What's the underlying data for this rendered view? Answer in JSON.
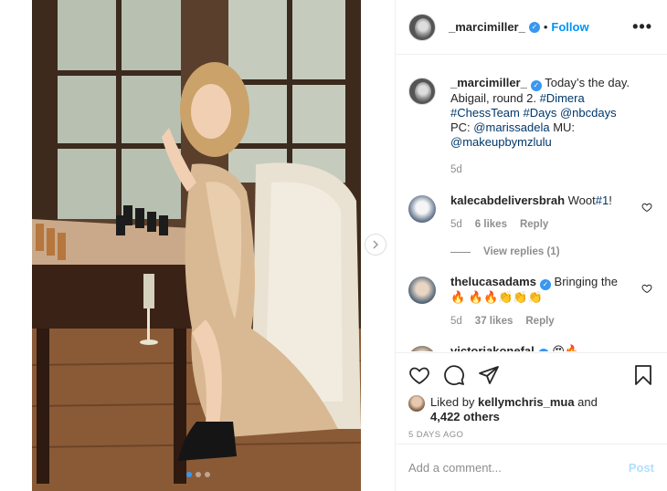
{
  "post": {
    "author": "_marcimiller_",
    "separator": "•",
    "follow_label": "Follow",
    "more_label": "•••",
    "verified_glyph": "✓",
    "next_icon": "chevron-right-icon"
  },
  "caption": {
    "username": "_marcimiller_",
    "text_1": " Today’s the day. Abigail, round 2. ",
    "tag_1": "#Dimera",
    "tag_2": "#ChessTeam",
    "tag_3": "#Days",
    "mention_1": "@nbcdays",
    "text_2": " PC: ",
    "mention_2": "@marissadela",
    "text_3": " MU: ",
    "mention_3": "@makeupbymzlulu",
    "age": "5d"
  },
  "comments": [
    {
      "username": "kalecabdeliversbrah",
      "text_before": " Woot",
      "tag": "#1",
      "text_after": "!",
      "age": "5d",
      "likes": "6 likes",
      "reply_label": "Reply",
      "view_replies": "View replies (1)"
    },
    {
      "username": "thelucasadams",
      "text": " Bringing the 🔥 🔥🔥👏👏👏",
      "age": "5d",
      "likes": "37 likes",
      "reply_label": "Reply"
    },
    {
      "username": "victoriakonefal",
      "text": " 😍🔥"
    }
  ],
  "likes": {
    "prefix": "Liked by ",
    "user": "kellymchris_mua",
    "middle": " and",
    "others": "4,422 others"
  },
  "timestamp": "5 DAYS AGO",
  "composer": {
    "placeholder": "Add a comment...",
    "post_label": "Post"
  },
  "colors": {
    "accent": "#0095f6",
    "verified": "#3897f0",
    "post_disabled": "#b2dffc"
  }
}
